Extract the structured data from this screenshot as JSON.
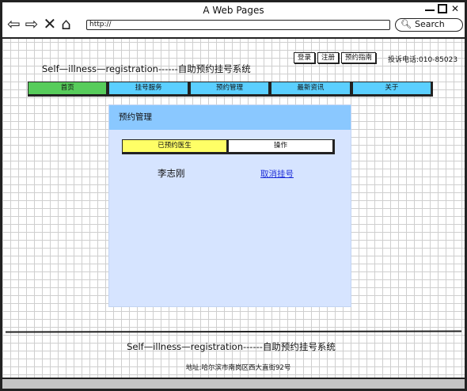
{
  "window": {
    "title": "A Web Pages",
    "url": "http://",
    "search_label": "Search"
  },
  "site": {
    "title": "Self—illness—registration------自助预约挂号系统",
    "links": [
      "登录",
      "注册",
      "预约指南"
    ],
    "complaint": "投诉电话:010-85023"
  },
  "menu": {
    "items": [
      "首页",
      "挂号服务",
      "预约管理",
      "最新资讯",
      "关于"
    ],
    "active_index": 0
  },
  "panel": {
    "title": "预约管理",
    "columns": [
      "已预约医生",
      "操作"
    ],
    "rows": [
      {
        "doctor": "李志刚",
        "action": "取消挂号"
      }
    ]
  },
  "footer": {
    "title": "Self—illness—registration------自助预约挂号系统",
    "address": "地址:哈尔滨市南岗区西大直街92号"
  },
  "colors": {
    "menu_bg": "#5bcfff",
    "menu_active": "#57cc5b",
    "panel_bg": "#d6e4ff",
    "panel_header": "#8ac8ff",
    "doctor_col": "#ffff66",
    "link": "#1a2bd8"
  }
}
